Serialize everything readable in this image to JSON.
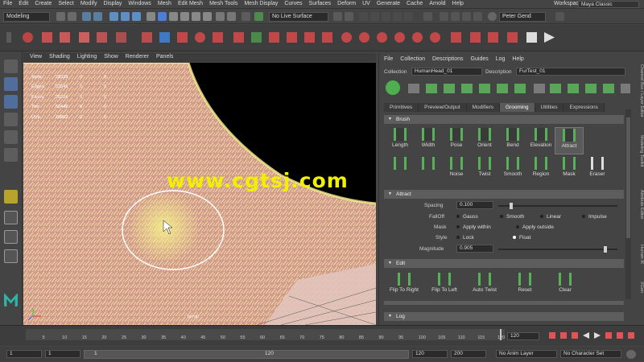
{
  "menubar": {
    "items": [
      "File",
      "Edit",
      "Create",
      "Select",
      "Modify",
      "Display",
      "Windows",
      "Mesh",
      "Edit Mesh",
      "Mesh Tools",
      "Mesh Display",
      "Curves",
      "Surfaces",
      "Deform",
      "UV",
      "Generate",
      "Cache",
      "Arnold",
      "Help"
    ],
    "workspace_label": "Workspace :",
    "workspace_value": "Maya Classic"
  },
  "statusline": {
    "mode": "Modeling",
    "live_surface": "No Live Surface",
    "user": "Peter Gend"
  },
  "viewport": {
    "menu": [
      "View",
      "Shading",
      "Lighting",
      "Show",
      "Renderer",
      "Panels"
    ],
    "hud": [
      {
        "k": "Verts:",
        "v": "28329",
        "a": "0",
        "b": "0"
      },
      {
        "k": "Edges:",
        "v": "52549",
        "a": "0",
        "b": "0"
      },
      {
        "k": "Faces:",
        "v": "26224",
        "a": "0",
        "b": "0"
      },
      {
        "k": "Tris:",
        "v": "52446",
        "a": "0",
        "b": "0"
      },
      {
        "k": "UVs:",
        "v": "28862",
        "a": "0",
        "b": "0"
      }
    ],
    "camera": "persp",
    "watermark": "www.cgtsj.com"
  },
  "xgen": {
    "menu": [
      "File",
      "Collection",
      "Descriptions",
      "Guides",
      "Log",
      "Help"
    ],
    "collection_label": "Collection",
    "collection_value": "HumanHead_01",
    "description_label": "Description",
    "description_value": "FurTest_01",
    "tabs": [
      "Primitives",
      "Preview/Output",
      "Modifiers",
      "Grooming",
      "Utilities",
      "Expressions"
    ],
    "active_tab": "Grooming",
    "brush_section": "Brush",
    "brushes_row1": [
      "Length",
      "Width",
      "Pose",
      "Orient",
      "Bend",
      "Elevation",
      "Attract"
    ],
    "brushes_row2": [
      "Noise",
      "Twist",
      "Smooth",
      "Region",
      "Mask",
      "Eraser"
    ],
    "selected_brush": "Attract",
    "attract_section": "Attract",
    "spacing_label": "Spacing",
    "spacing_value": "0.100",
    "falloff_label": "FallOff",
    "falloff_options": [
      "Gauss",
      "Smooth",
      "Linear",
      "Impulse"
    ],
    "mask_label": "Mask",
    "mask_options": [
      "Apply within",
      "Apply outside"
    ],
    "style_label": "Style",
    "style_options": [
      "Lock",
      "Float"
    ],
    "magnitude_label": "Magnitude",
    "magnitude_value": "0.905",
    "edit_section": "Edit",
    "edit_actions": [
      "Flip To Right",
      "Flip To Left",
      "Auto Twist",
      "Reset",
      "Clear"
    ],
    "log_section": "Log"
  },
  "side_tabs": [
    "Channel Box / Layer Editor",
    "Modeling Toolkit",
    "Attribute Editor",
    "Human IK",
    "XGen"
  ],
  "timeline": {
    "ticks": [
      "5",
      "10",
      "15",
      "20",
      "25",
      "30",
      "35",
      "40",
      "45",
      "50",
      "55",
      "60",
      "65",
      "70",
      "75",
      "80",
      "85",
      "90",
      "95",
      "100",
      "105",
      "110",
      "115",
      "120"
    ],
    "current_frame": "120",
    "end_frame": "120"
  },
  "range": {
    "start": "1",
    "start2": "1",
    "slider_start": "1",
    "slider_end": "120",
    "end": "120",
    "end2": "200",
    "anim_layer": "No Anim Layer",
    "char_set": "No Character Set"
  }
}
